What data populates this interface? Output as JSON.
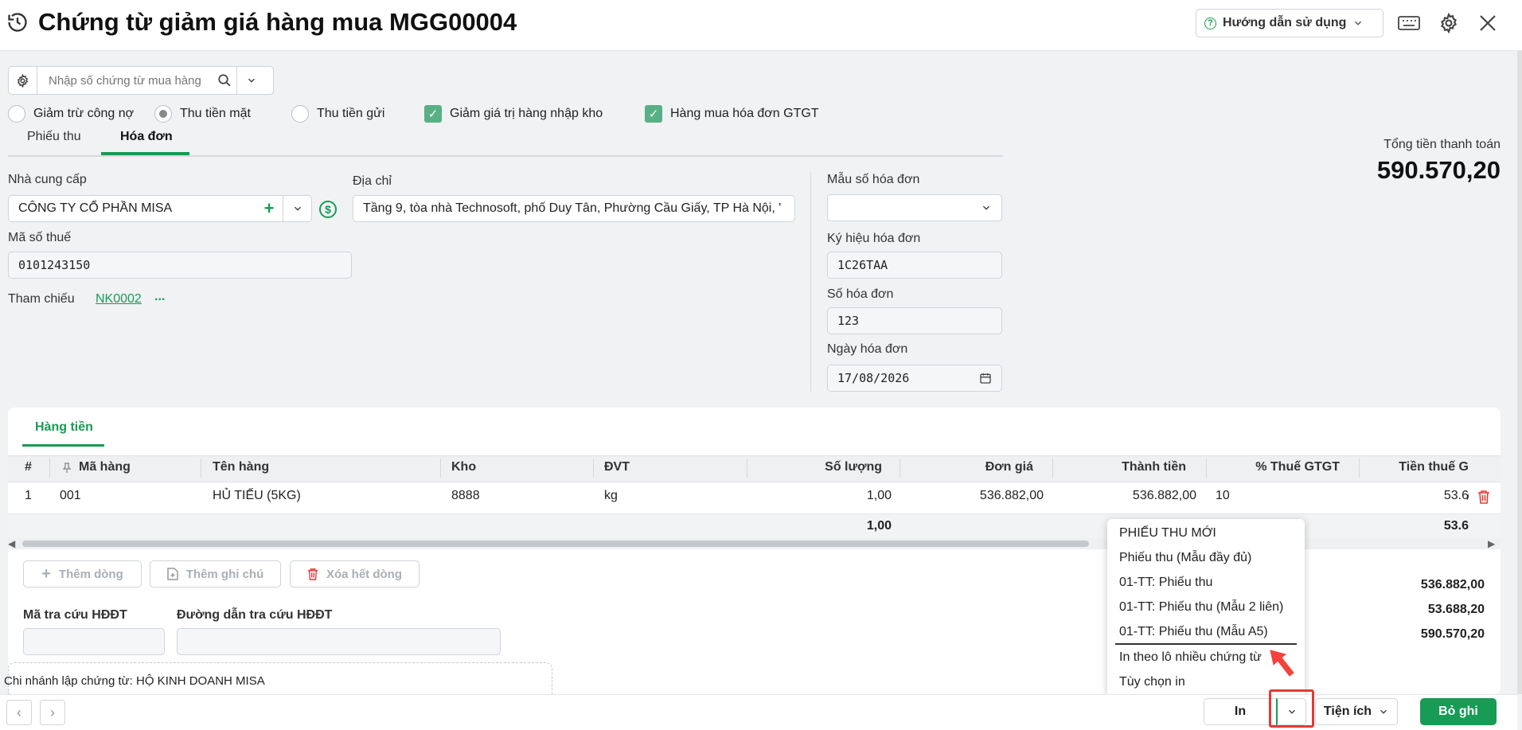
{
  "header": {
    "title": "Chứng từ giảm giá hàng mua MGG00004",
    "help_label": "Hướng dẫn sử dụng"
  },
  "search": {
    "placeholder": "Nhập số chứng từ mua hàng"
  },
  "options": {
    "giam_tru": "Giảm trừ công nợ",
    "thu_tien_mat": "Thu tiền mặt",
    "thu_tien_gui": "Thu tiền gửi",
    "giam_gia_tri": "Giảm giá trị hàng nhập kho",
    "hang_mua_hd": "Hàng mua hóa đơn GTGT",
    "selected": "Thu tiền mặt"
  },
  "tabs": {
    "phieu_thu": "Phiếu thu",
    "hoa_don": "Hóa đơn",
    "active": "Hóa đơn"
  },
  "form": {
    "supplier_label": "Nhà cung cấp",
    "supplier_value": "CÔNG TY CỔ PHẦN MISA",
    "address_label": "Địa chỉ",
    "address_value": "Tầng 9, tòa nhà Technosoft, phố Duy Tân, Phường Cầu Giấy, TP Hà Nội, '",
    "tax_label": "Mã số thuế",
    "tax_value": "0101243150",
    "ref_label": "Tham chiếu",
    "ref_value": "NK0002",
    "ref_more": "...",
    "invoice_form_label": "Mẫu số hóa đơn",
    "invoice_form_value": "",
    "invoice_symbol_label": "Ký hiệu hóa đơn",
    "invoice_symbol_value": "1C26TAA",
    "invoice_no_label": "Số hóa đơn",
    "invoice_no_value": "123",
    "invoice_date_label": "Ngày hóa đơn",
    "invoice_date_value": "17/08/2026"
  },
  "total": {
    "label": "Tổng tiền thanh toán",
    "value": "590.570,20"
  },
  "grid": {
    "tab": "Hàng tiền",
    "columns": {
      "idx": "#",
      "code": "Mã hàng",
      "name": "Tên hàng",
      "warehouse": "Kho",
      "unit": "ĐVT",
      "qty": "Số lượng",
      "price": "Đơn giá",
      "amount": "Thành tiền",
      "vat": "% Thuế GTGT",
      "vat_amount": "Tiền thuế G"
    },
    "rows": [
      {
        "idx": "1",
        "code": "001",
        "name": "HỦ TIẾU (5KG)",
        "warehouse": "8888",
        "unit": "kg",
        "qty": "1,00",
        "price": "536.882,00",
        "amount": "536.882,00",
        "vat": "10",
        "vat_amount": "53.6̸"
      }
    ],
    "sum": {
      "qty": "1,00",
      "vat_amount": "53.6"
    }
  },
  "actions": {
    "add_row": "Thêm dòng",
    "add_note": "Thêm ghi chú",
    "delete_all": "Xóa hết dòng"
  },
  "einvoice": {
    "lookup_code_label": "Mã tra cứu HĐĐT",
    "lookup_url_label": "Đường dẫn tra cứu HĐĐT"
  },
  "summary": {
    "line1": "536.882,00",
    "line2": "53.688,20",
    "line3": "590.570,20"
  },
  "branch": "Chi nhánh lập chứng từ: HỘ KINH DOANH MISA",
  "print_menu": {
    "items": [
      "PHIẾU THU MỚI",
      "Phiếu thu (Mẫu đầy đủ)",
      "01-TT: Phiếu thu",
      "01-TT: Phiếu thu (Mẫu 2 liên)",
      "01-TT: Phiếu thu (Mẫu A5)",
      "In theo lô nhiều chứng từ",
      "Tùy chọn in"
    ]
  },
  "footer": {
    "print": "In",
    "utilities": "Tiện ích",
    "save": "Bỏ ghi"
  },
  "colors": {
    "accent": "#189b54",
    "highlight": "#e53935"
  }
}
